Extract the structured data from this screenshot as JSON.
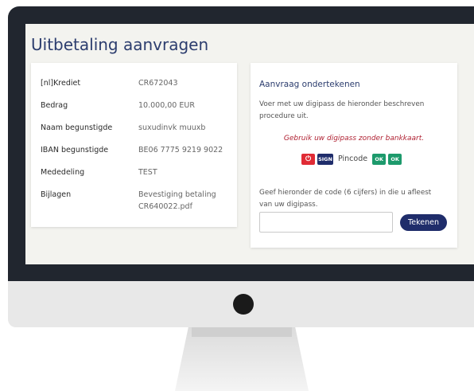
{
  "page": {
    "title": "Uitbetaling aanvragen"
  },
  "details": [
    {
      "label": "[nl]Krediet",
      "value": "CR672043"
    },
    {
      "label": "Bedrag",
      "value": "10.000,00 EUR"
    },
    {
      "label": "Naam begunstigde",
      "value": "suxudinvk muuxb"
    },
    {
      "label": "IBAN begunstigde",
      "value": "BE06 7775 9219 9022"
    },
    {
      "label": "Mededeling",
      "value": "TEST"
    },
    {
      "label": "Bijlagen",
      "value": "Bevestiging betaling CR640022.pdf"
    }
  ],
  "sign": {
    "title": "Aanvraag ondertekenen",
    "instruction": "Voer met uw digipass de hieronder beschreven procedure uit.",
    "warning": "Gebruik uw digipass zonder bankkaart.",
    "digipass": {
      "power_symbol": "⏻",
      "sign_key": "SIGN",
      "pincode_label": "Pincode",
      "ok_key_1": "OK",
      "ok_key_2": "OK"
    },
    "code_instruction": "Geef hieronder de code (6 cijfers) in die u afleest van uw digipass.",
    "code_value": "",
    "submit_label": "Tekenen"
  },
  "colors": {
    "title": "#2c3d6e",
    "primary_button": "#1f2d6b",
    "warning": "#b02233",
    "power_key": "#e02b35",
    "ok_key": "#1d9a6c"
  }
}
